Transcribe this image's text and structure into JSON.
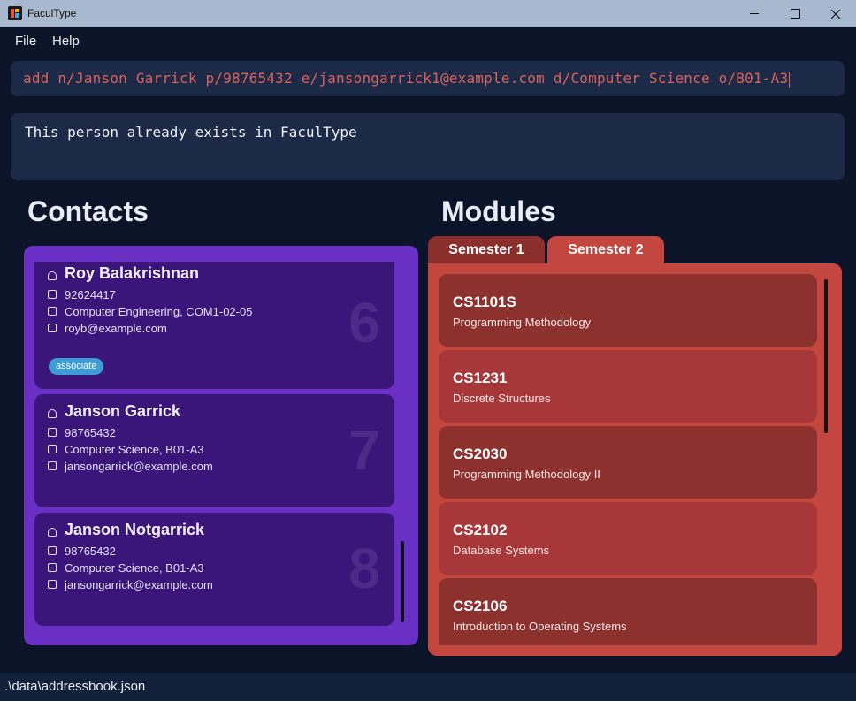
{
  "window": {
    "title": "FaculType"
  },
  "menu": [
    "File",
    "Help"
  ],
  "command": {
    "value": "add n/Janson Garrick p/98765432 e/jansongarrick1@example.com d/Computer Science o/B01-A3"
  },
  "result": {
    "message": "This person already exists in FaculType"
  },
  "contacts": {
    "title": "Contacts",
    "cards": [
      {
        "name": "Roy Balakrishnan",
        "phone": "92624417",
        "office": "Computer Engineering, COM1-02-05",
        "email": "royb@example.com",
        "tag": "associate",
        "index": "6"
      },
      {
        "name": "Janson Garrick",
        "phone": "98765432",
        "office": "Computer Science, B01-A3",
        "email": "jansongarrick@example.com",
        "index": "7"
      },
      {
        "name": "Janson Notgarrick",
        "phone": "98765432",
        "office": "Computer Science, B01-A3",
        "email": "jansongarrick@example.com",
        "index": "8"
      }
    ]
  },
  "modules": {
    "title": "Modules",
    "tabs": [
      "Semester 1",
      "Semester 2"
    ],
    "selected_tab": "Semester 2",
    "items": [
      {
        "code": "CS1101S",
        "name": "Programming Methodology"
      },
      {
        "code": "CS1231",
        "name": "Discrete Structures"
      },
      {
        "code": "CS2030",
        "name": "Programming Methodology II"
      },
      {
        "code": "CS2102",
        "name": "Database Systems"
      },
      {
        "code": "CS2106",
        "name": "Introduction to Operating Systems"
      }
    ]
  },
  "status": {
    "path": ".\\data\\addressbook.json"
  },
  "icons": [
    "app-icon",
    "minimize-icon",
    "maximize-icon",
    "close-icon",
    "person-icon",
    "phone-icon",
    "briefcase-icon",
    "mail-icon"
  ],
  "colors": {
    "background": "#0b1428",
    "contacts_panel": "#6a2fc4",
    "contact_card": "#3a157a",
    "modules_panel": "#c4473f",
    "command_text": "#d9625a",
    "tag": "#3d9bd6"
  }
}
